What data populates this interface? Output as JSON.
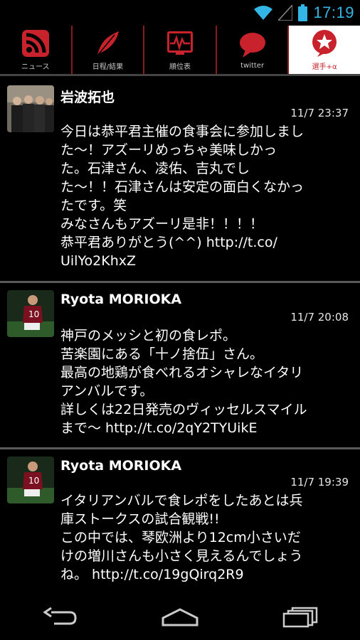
{
  "status": {
    "time": "17:19"
  },
  "tabs": [
    {
      "label": "ニュース",
      "icon": "rss-icon"
    },
    {
      "label": "日程/結果",
      "icon": "feather-icon"
    },
    {
      "label": "順位表",
      "icon": "chart-icon"
    },
    {
      "label": "twitter",
      "icon": "speech-bubble-icon"
    },
    {
      "label": "選手+α",
      "icon": "star-icon"
    }
  ],
  "colors": {
    "accent": "#c8232c",
    "statusBlue": "#33b5e5",
    "tabDivider": "#8b1a1a"
  },
  "tweets": [
    {
      "name": "岩波拓也",
      "time": "11/7 23:37",
      "lines": [
        "今日は恭平君主催の食事会に参加しまし",
        "た〜！アズーリめっちゃ美味しかっ",
        "た。石津さん、凌佑、吉丸でし",
        "た〜！！石津さんは安定の面白くなかっ",
        "たです。笑",
        "みなさんもアズーリ是非！！！！",
        "恭平君ありがとう(^^) http://t.co/",
        "UilYo2KhxZ"
      ]
    },
    {
      "name": "Ryota MORIOKA",
      "time": "11/7 20:08",
      "lines": [
        "神戸のメッシと初の食レポ。",
        "苦楽園にある「十ノ捨伍」さん。",
        "最高の地鶏が食べれるオシャレなイタリ",
        "アンバルです。",
        "詳しくは22日発売のヴィッセルスマイル",
        "まで〜 http://t.co/2qY2TYUikE"
      ]
    },
    {
      "name": "Ryota MORIOKA",
      "time": "11/7 19:39",
      "lines": [
        "イタリアンバルで食レポをしたあとは兵",
        "庫ストークスの試合観戦!!",
        "この中では、琴欧洲より12cm小さいだ",
        "けの増川さんも小さく見えるんでしょう",
        "ね。 http://t.co/19gQirq2R9"
      ]
    }
  ]
}
